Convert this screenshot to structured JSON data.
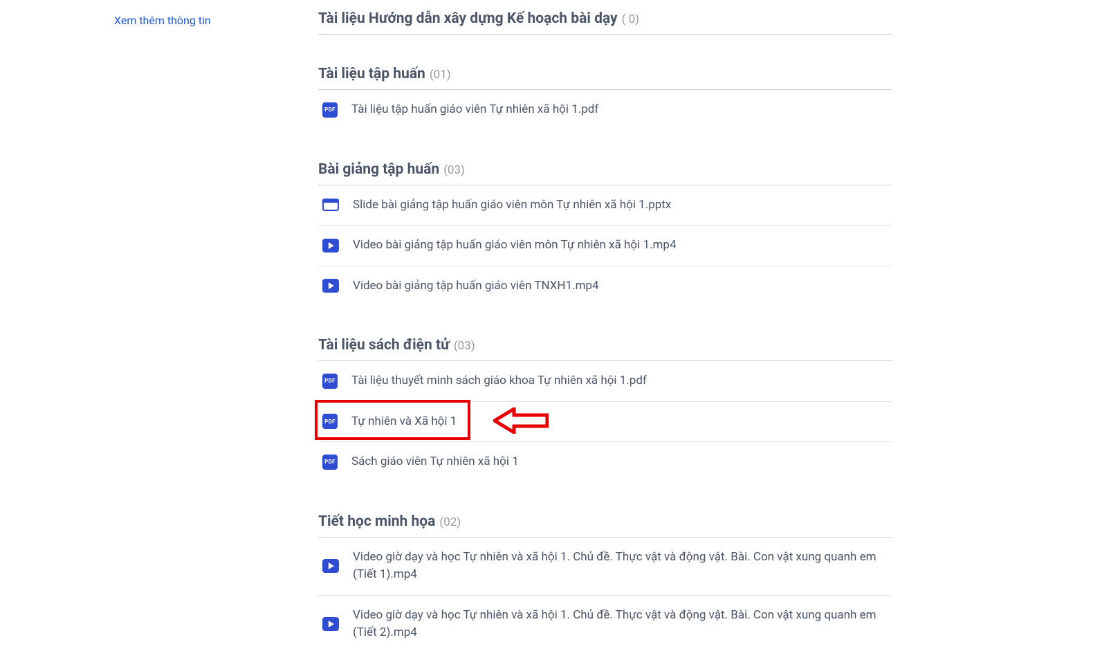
{
  "sidebar": {
    "more_info_link": "Xem thêm thông tin"
  },
  "sections": [
    {
      "title": "Tài liệu Hướng dẫn xây dựng Kế hoạch bài dạy",
      "count": "( 0)",
      "items": []
    },
    {
      "title": "Tài liệu tập huấn",
      "count": "(01)",
      "items": [
        {
          "icon": "pdf",
          "label": "Tài liệu tập huấn giáo viên Tự nhiên xã hội 1.pdf"
        }
      ]
    },
    {
      "title": "Bài giảng tập huấn",
      "count": "(03)",
      "items": [
        {
          "icon": "slide",
          "label": "Slide bài giảng tập huấn giáo viên môn Tự nhiên xã hội 1.pptx"
        },
        {
          "icon": "video",
          "label": "Video bài giảng tập huấn giáo viên môn Tự nhiên xã hội 1.mp4"
        },
        {
          "icon": "video",
          "label": "Video bài giảng tập huấn giáo viên TNXH1.mp4"
        }
      ]
    },
    {
      "title": "Tài liệu sách điện tử",
      "count": "(03)",
      "items": [
        {
          "icon": "pdf",
          "label": "Tài liệu thuyết minh sách giáo khoa Tự nhiên xã hội 1.pdf"
        },
        {
          "icon": "pdf",
          "label": "Tự nhiên và Xã hội 1",
          "highlight": true
        },
        {
          "icon": "pdf",
          "label": "Sách giáo viên Tự nhiên xã hội 1"
        }
      ]
    },
    {
      "title": "Tiết học minh họa",
      "count": "(02)",
      "items": [
        {
          "icon": "video",
          "label": "Video giờ dạy và học Tự nhiên và xã hội 1. Chủ đề. Thực vật và động vật. Bài. Con vật xung quanh em (Tiết 1).mp4"
        },
        {
          "icon": "video",
          "label": "Video giờ dạy và học Tự nhiên và xã hội 1. Chủ đề. Thực vật và động vật. Bài. Con vật xung quanh em (Tiết 2).mp4"
        }
      ]
    }
  ]
}
